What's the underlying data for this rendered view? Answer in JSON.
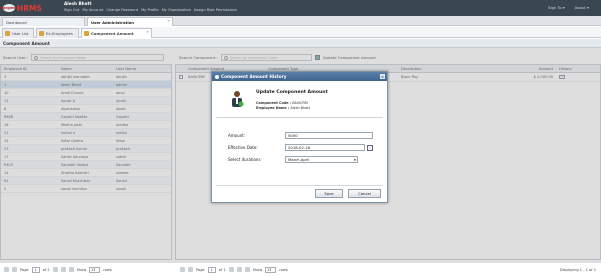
{
  "header": {
    "logo_text": "Orangehrm",
    "app_name": "HRMS",
    "user_name": "Alesh Bhatt",
    "user_links": [
      "Sign Out",
      "My Account",
      "Change Password",
      "My Profile",
      "My Organization",
      "Assign Role Permissions"
    ],
    "right_links": [
      "Sign To ▾",
      "About ▾"
    ]
  },
  "top_tabs": [
    {
      "label": "Dashboard",
      "active": false
    },
    {
      "label": "User Administration",
      "active": true
    }
  ],
  "sub_tabs": [
    {
      "label": "User List",
      "active": false
    },
    {
      "label": "Ex-Employees",
      "active": false
    },
    {
      "label": "Component Amount",
      "active": true
    }
  ],
  "section_title": "Component Amount",
  "left_toolbar": {
    "label": "Search User :",
    "placeholder": "Search by Employee Name"
  },
  "right_toolbar": {
    "label": "Search Component :",
    "placeholder": "Search by Component Code",
    "update_button": "Update Component Amount"
  },
  "employee_table": {
    "columns": [
      "Employee ID",
      "Name",
      "User Name"
    ],
    "rows": [
      [
        "3",
        "abhijit inamdath",
        "abhijit"
      ],
      [
        "1",
        "Alesh Bhatt",
        "admin"
      ],
      [
        "10",
        "Amol Chaure",
        "amol"
      ],
      [
        "11",
        "Ayush A",
        "ayush"
      ],
      [
        "6",
        "dipankahar",
        "dipak"
      ],
      [
        "R658",
        "Gayatri Naakte",
        "Gayatri"
      ],
      [
        "16",
        "Medha Joshi",
        "medha"
      ],
      [
        "21",
        "mehul n",
        "mehul"
      ],
      [
        "15",
        "Nihal Gadhvi",
        "Nihal"
      ],
      [
        "23",
        "prakash kumar",
        "prakash"
      ],
      [
        "17",
        "Satish Sarvaiya",
        "satish"
      ],
      [
        "P403",
        "Saurabh Vaidya",
        "Saurabh"
      ],
      [
        "14",
        "Shweta Kalantri",
        "shweta"
      ],
      [
        "61",
        "Sonali Khochikar",
        "Sonali"
      ],
      [
        "5",
        "sonali kochikar",
        "sonali"
      ]
    ],
    "selected_index": 1
  },
  "component_table": {
    "columns": [
      "",
      "Component Amount",
      "Component Type",
      "Description",
      "Amount",
      "History"
    ],
    "rows": [
      [
        "",
        "BASICPAY",
        "Earning",
        "Basic Pay",
        "$ 2,000.00",
        ""
      ]
    ]
  },
  "left_pager": {
    "page_label": "Page",
    "page_value": "1",
    "of_label": "of 2",
    "show_label": "Show",
    "show_value": "15",
    "rows_label": "rows"
  },
  "right_pager": {
    "page_label": "Page",
    "page_value": "1",
    "of_label": "of 1",
    "show_label": "Show",
    "show_value": "15",
    "rows_label": "rows",
    "display_label": "Displaying 1 - 1 of 1"
  },
  "dialog": {
    "title": "Component Amount History",
    "close": "×",
    "heading": "Update Component Amount",
    "component_code_label": "Component Code :",
    "component_code": "BASICPAY",
    "employee_name_label": "Employee Name :",
    "employee_name": "Alesh Bhatt",
    "amount_label": "Amount:",
    "amount_value": "5000",
    "effective_date_label": "Effective Date:",
    "effective_date_value": "2018-02-16",
    "duration_label": "Select durations",
    "duration_value": "March,April",
    "save_label": "Save",
    "cancel_label": "Cancel"
  },
  "colors": {
    "header_bg": "#3a4650",
    "brand_red": "#e03a3a",
    "dialog_title": "#4a719a",
    "selected_row": "#cfe2f3"
  }
}
